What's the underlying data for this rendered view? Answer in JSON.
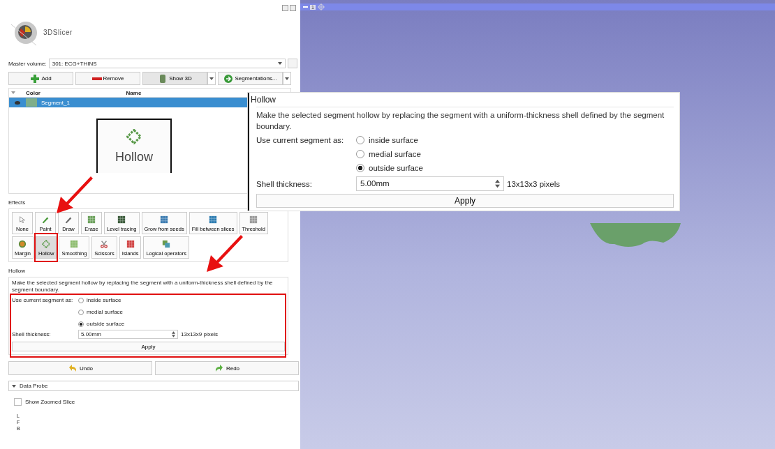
{
  "app": {
    "logo_text": "3DSlicer"
  },
  "master_volume": {
    "label": "Master volume:",
    "value": "301: ECG+THINS"
  },
  "toolbar": [
    {
      "kind": "add",
      "label": "Add"
    },
    {
      "kind": "remove",
      "label": "Remove"
    },
    {
      "kind": "show3d",
      "label": "Show 3D"
    },
    {
      "kind": "segmentations",
      "label": "Segmentations..."
    }
  ],
  "segments_table": {
    "columns": [
      "Color",
      "Name"
    ],
    "rows": [
      {
        "name": "Segment_1",
        "color": "#7fae8a",
        "visible": true,
        "selected": true
      }
    ]
  },
  "effects": {
    "title": "Effects",
    "rows": [
      [
        {
          "kind": "none",
          "label": "None",
          "selected": false
        },
        {
          "kind": "paint",
          "label": "Paint",
          "selected": false
        },
        {
          "kind": "draw",
          "label": "Draw",
          "selected": false
        },
        {
          "kind": "erase",
          "label": "Erase",
          "selected": false
        },
        {
          "kind": "level",
          "label": "Level tracing",
          "selected": false
        },
        {
          "kind": "grow",
          "label": "Grow from seeds",
          "selected": false
        },
        {
          "kind": "fill",
          "label": "Fill between slices",
          "selected": false
        },
        {
          "kind": "threshold",
          "label": "Threshold",
          "selected": false
        }
      ],
      [
        {
          "kind": "margin",
          "label": "Margin",
          "selected": false
        },
        {
          "kind": "hollow",
          "label": "Hollow",
          "selected": true
        },
        {
          "kind": "smoothing",
          "label": "Smoothing",
          "selected": false
        },
        {
          "kind": "scissors",
          "label": "Scissors",
          "selected": false
        },
        {
          "kind": "islands",
          "label": "Islands",
          "selected": false
        },
        {
          "kind": "logical",
          "label": "Logical operators",
          "selected": false
        }
      ]
    ]
  },
  "hollow_panel": {
    "title": "Hollow",
    "description": "Make the selected segment hollow by replacing the segment with a uniform-thickness shell defined by the segment boundary.",
    "use_as_label": "Use current segment as:",
    "options": [
      {
        "label": "inside surface",
        "selected": false
      },
      {
        "label": "medial surface",
        "selected": false
      },
      {
        "label": "outside surface",
        "selected": true
      }
    ],
    "thickness_label": "Shell thickness:",
    "thickness_value": "5.00mm",
    "pixels": "13x13x9 pixels",
    "apply": "Apply"
  },
  "history": {
    "undo": "Undo",
    "redo": "Redo"
  },
  "data_probe": {
    "title": "Data Probe",
    "expanded": true,
    "show_zoomed_slice": {
      "label": "Show Zoomed Slice",
      "checked": false
    },
    "axes": [
      "L",
      "F",
      "B"
    ]
  },
  "view": {
    "slice_label": "1"
  },
  "zoomed_button": {
    "label": "Hollow"
  },
  "callout": {
    "title": "Hollow",
    "description": "Make the selected segment hollow by replacing the segment with a uniform-thickness shell defined by the segment boundary.",
    "use_as_label": "Use current segment as:",
    "options": [
      {
        "label": "inside surface",
        "selected": false
      },
      {
        "label": "medial surface",
        "selected": false
      },
      {
        "label": "outside surface",
        "selected": true
      }
    ],
    "thickness_label": "Shell thickness:",
    "thickness_value": "5.00mm",
    "pixels": "13x13x3 pixels",
    "apply": "Apply"
  }
}
